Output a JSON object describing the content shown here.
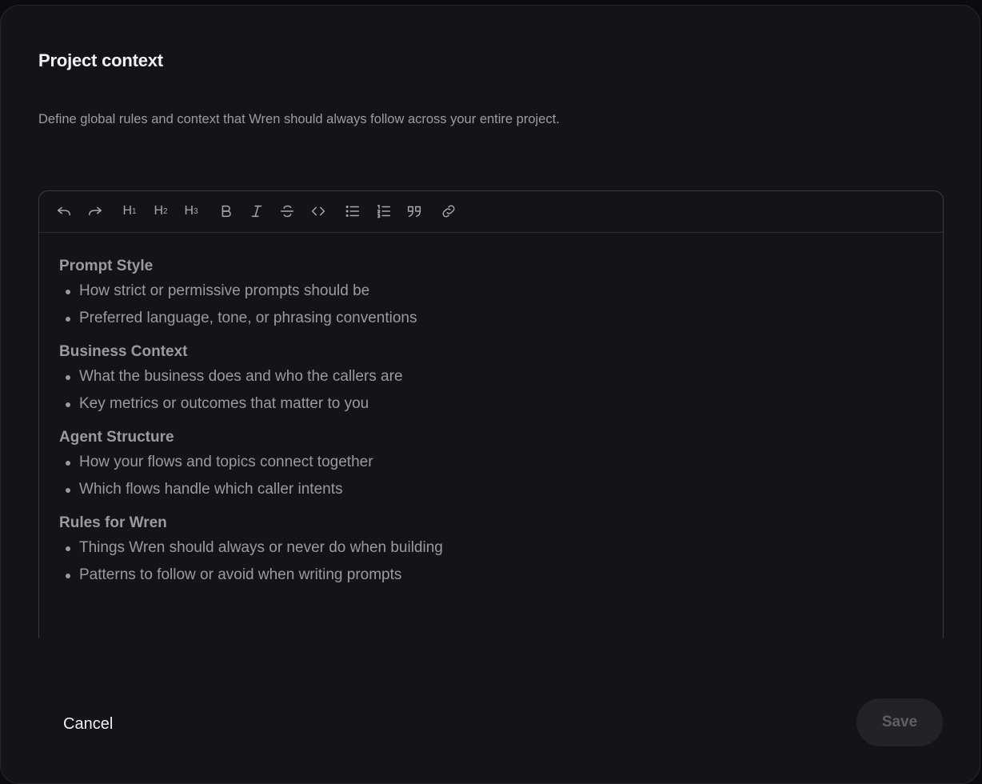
{
  "dialog": {
    "title": "Project context",
    "description": "Define global rules and context that Wren should always follow across your entire project."
  },
  "toolbar": {
    "h1": "H",
    "h1_sub": "1",
    "h2": "H",
    "h2_sub": "2",
    "h3": "H",
    "h3_sub": "3",
    "icons": [
      "undo-icon",
      "redo-icon",
      "heading-1-icon",
      "heading-2-icon",
      "heading-3-icon",
      "bold-icon",
      "italic-icon",
      "strikethrough-icon",
      "code-icon",
      "bullet-list-icon",
      "ordered-list-icon",
      "quote-icon",
      "link-icon"
    ]
  },
  "editor": {
    "sections": [
      {
        "heading": "Prompt Style",
        "items": [
          "How strict or permissive prompts should be",
          "Preferred language, tone, or phrasing conventions"
        ]
      },
      {
        "heading": "Business Context",
        "items": [
          "What the business does and who the callers are",
          "Key metrics or outcomes that matter to you"
        ]
      },
      {
        "heading": "Agent Structure",
        "items": [
          "How your flows and topics connect together",
          "Which flows handle which caller intents"
        ]
      },
      {
        "heading": "Rules for Wren",
        "items": [
          "Things Wren should always or never do when building",
          "Patterns to follow or avoid when writing prompts"
        ]
      }
    ]
  },
  "footer": {
    "cancel_label": "Cancel",
    "save_label": "Save"
  },
  "colors": {
    "background": "#141418",
    "text_primary": "#f2f2f4",
    "text_muted": "#9a9aa1",
    "save_disabled_bg": "#232327"
  }
}
